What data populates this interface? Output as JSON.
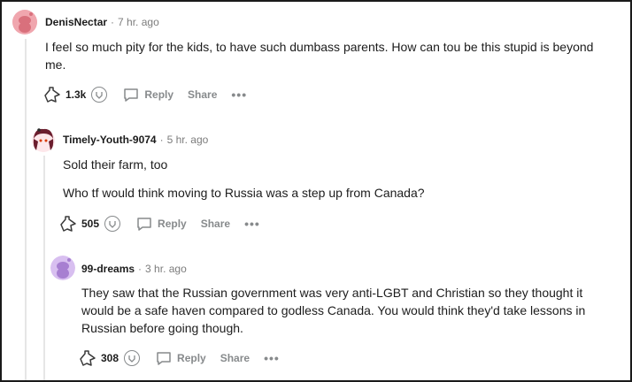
{
  "comments": [
    {
      "author": "DenisNectar",
      "time": "7 hr. ago",
      "body": [
        "I feel so much pity for the kids, to have such dumbass parents. How can tou be this stupid is beyond me."
      ],
      "votes": "1.3k",
      "reply_label": "Reply",
      "share_label": "Share",
      "more_label": "•••",
      "avatar_color": "#e8a0a8"
    },
    {
      "author": "Timely-Youth-9074",
      "time": "5 hr. ago",
      "body": [
        "Sold their farm, too",
        "Who tf would think moving to Russia was a step up from Canada?"
      ],
      "votes": "505",
      "reply_label": "Reply",
      "share_label": "Share",
      "more_label": "•••",
      "avatar_color": "#6b1e2e"
    },
    {
      "author": "99-dreams",
      "time": "3 hr. ago",
      "body": [
        "They saw that the Russian government was very anti-LGBT and Christian so they thought it would be a safe haven compared to godless Canada. You would think they'd take lessons in Russian before going though."
      ],
      "votes": "308",
      "reply_label": "Reply",
      "share_label": "Share",
      "more_label": "•••",
      "avatar_color": "#c9a4e6"
    }
  ],
  "separator": "·"
}
